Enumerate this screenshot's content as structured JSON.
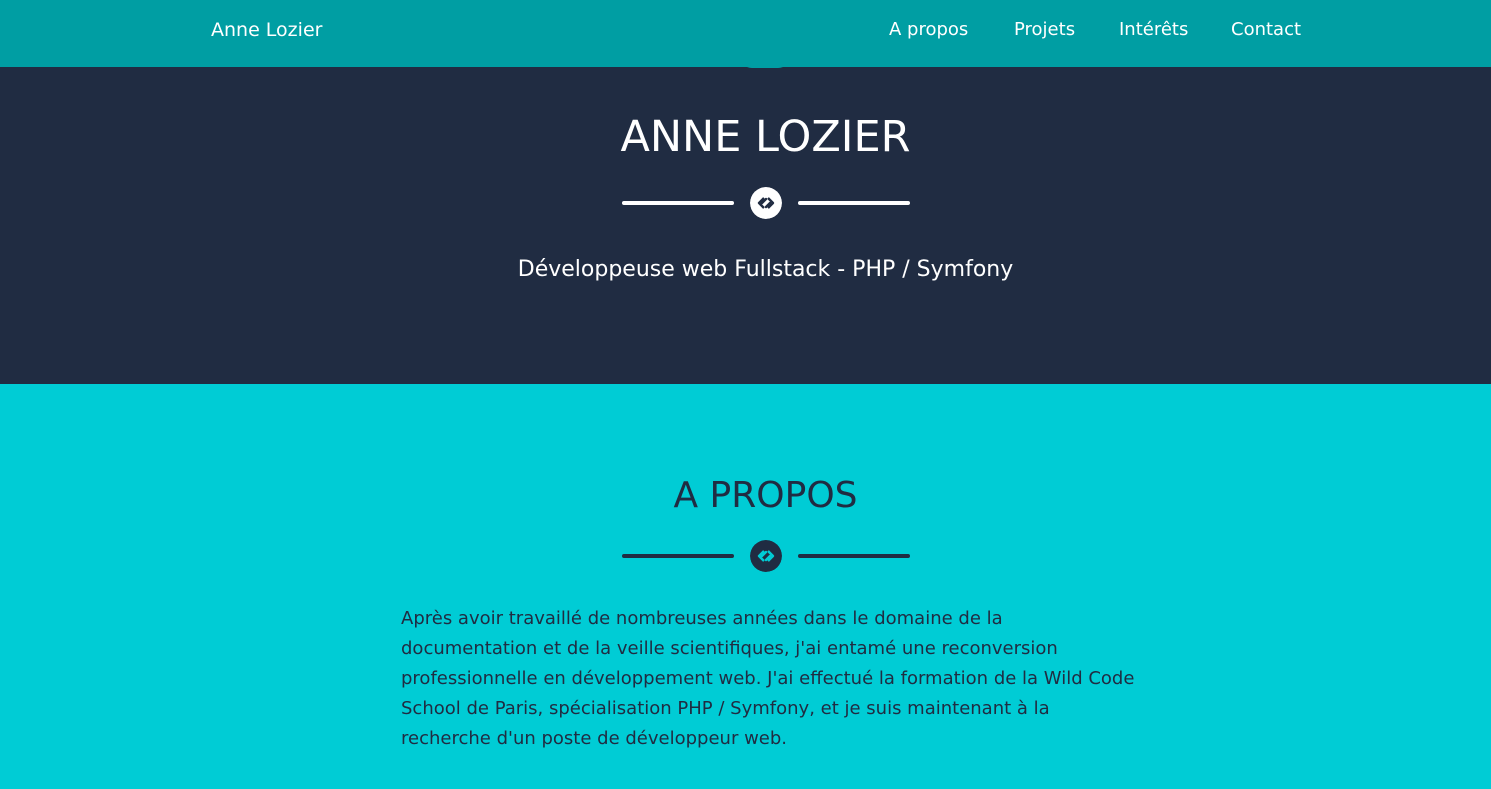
{
  "colors": {
    "nav_bg": "#009ea3",
    "hero_bg": "#202c42",
    "about_bg": "#00ccd5",
    "white": "#ffffff"
  },
  "nav": {
    "brand": "Anne Lozier",
    "links": [
      {
        "label": "A propos"
      },
      {
        "label": "Projets"
      },
      {
        "label": "Intérêts"
      },
      {
        "label": "Contact"
      }
    ]
  },
  "hero": {
    "title": "ANNE LOZIER",
    "divider_icon": "code-link-icon",
    "subtitle": "Développeuse web Fullstack - PHP / Symfony"
  },
  "about": {
    "title": "A PROPOS",
    "divider_icon": "code-link-icon",
    "text": "Après avoir travaillé de nombreuses années dans le domaine de la documentation et de la veille scientifiques, j'ai entamé une reconversion professionnelle en développement web. J'ai effectué la formation de la Wild Code School de Paris, spécialisation PHP / Symfony, et je suis maintenant à la recherche d'un poste de développeur web."
  }
}
